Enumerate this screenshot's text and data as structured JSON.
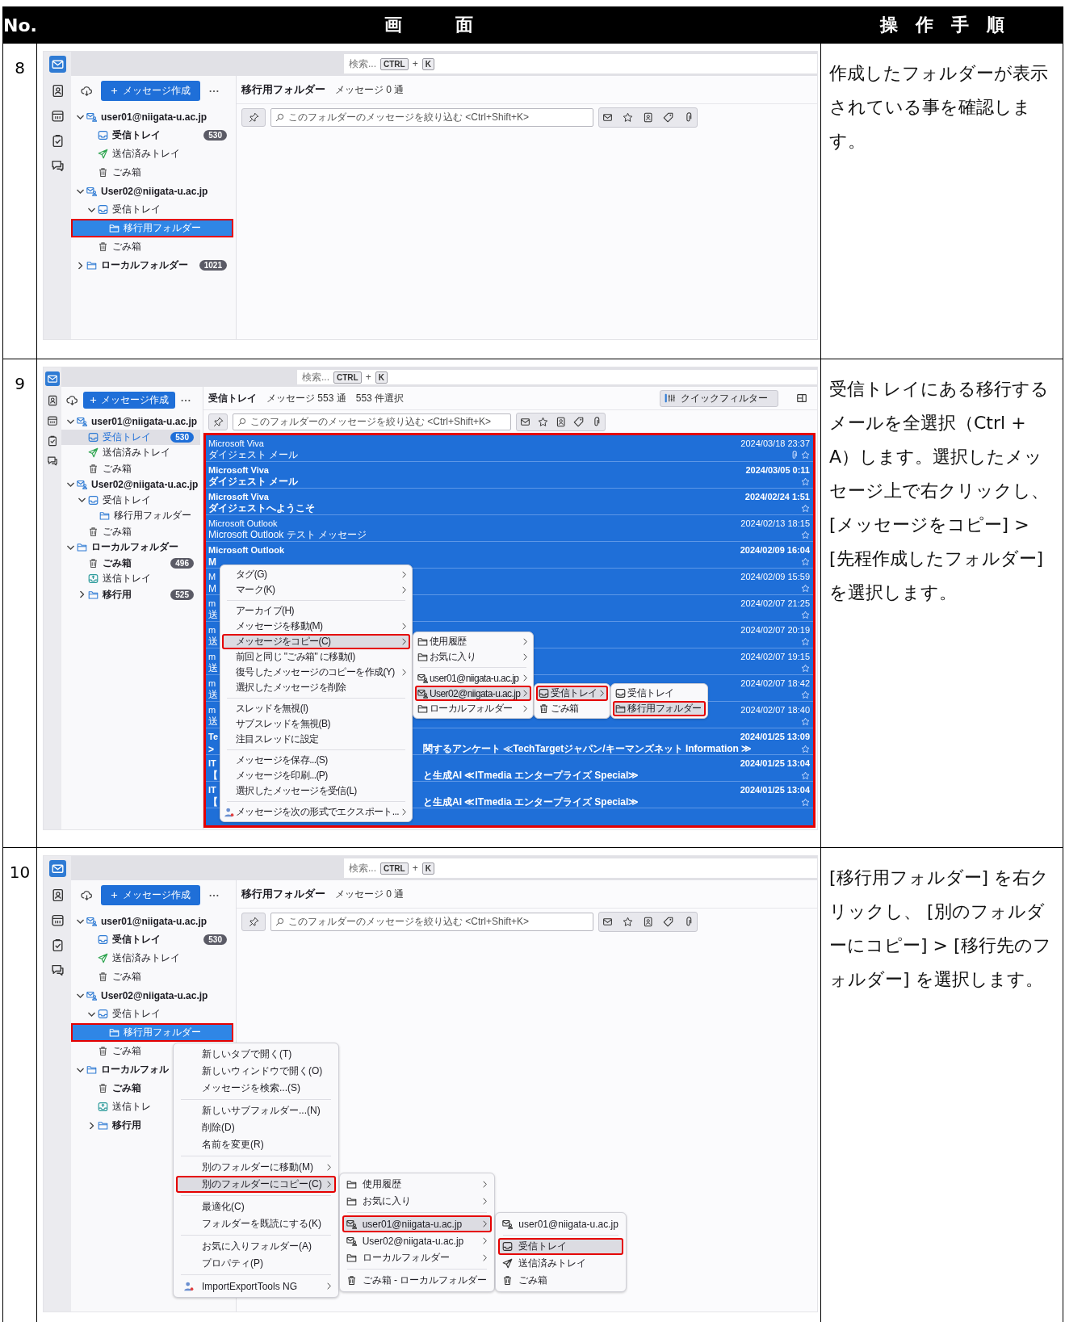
{
  "table": {
    "columns": [
      "No.",
      "画　　　面",
      "操　作　手　順"
    ]
  },
  "rows": [
    {
      "number": "8",
      "instructions": "作成したフォルダーが表示されている事を確認します。",
      "screen": {
        "search": {
          "placeholder": "検索...",
          "joiner": "+",
          "keys": [
            "CTRL",
            "K"
          ]
        },
        "compose_button": "メッセージ作成",
        "folder_pane_focused": true,
        "folders": [
          {
            "label": "user01@niigata-u.ac.jp",
            "kind": "account",
            "bold": true,
            "expanded": true,
            "selected": false,
            "outlined": false,
            "children": [
              {
                "label": "受信トレイ",
                "kind": "inbox",
                "bold": true,
                "count": "530",
                "selected": false,
                "outlined": false
              },
              {
                "label": "送信済みトレイ",
                "kind": "sent",
                "bold": false,
                "selected": false,
                "outlined": false
              },
              {
                "label": "ごみ箱",
                "kind": "trash",
                "bold": false,
                "selected": false,
                "outlined": false
              }
            ]
          },
          {
            "label": "User02@niigata-u.ac.jp",
            "kind": "account",
            "bold": true,
            "expanded": true,
            "selected": false,
            "outlined": false,
            "children": [
              {
                "label": "受信トレイ",
                "kind": "inbox",
                "bold": false,
                "expanded": true,
                "selected": false,
                "outlined": false,
                "children": [
                  {
                    "label": "移行用フォルダー",
                    "kind": "folder",
                    "bold": false,
                    "selected": true,
                    "outlined": true
                  }
                ]
              },
              {
                "label": "ごみ箱",
                "kind": "trash",
                "bold": false,
                "selected": false,
                "outlined": false
              }
            ]
          },
          {
            "label": "ローカルフォルダー",
            "kind": "folder",
            "bold": true,
            "expanded": false,
            "count": "1021",
            "selected": false,
            "outlined": false
          }
        ],
        "folder_title": "移行用フォルダー",
        "folder_info": [
          "メッセージ 0 通"
        ],
        "filter": {
          "placeholder": "このフォルダーのメッセージを絞り込む <Ctrl+Shift+K>"
        }
      }
    },
    {
      "number": "9",
      "instructions": "受信トレイにある移行するメールを全選択（Ctrl + A）します。選択したメッセージ上で右クリックし、[メッセージをコピー] > [先程作成したフォルダー] を選択します。",
      "screen": {
        "search": {
          "placeholder": "検索...",
          "joiner": "+",
          "keys": [
            "CTRL",
            "K"
          ]
        },
        "compose_button": "メッセージ作成",
        "folder_pane_focused": false,
        "folders": [
          {
            "label": "user01@niigata-u.ac.jp",
            "kind": "account",
            "bold": true,
            "expanded": true,
            "selected": false,
            "outlined": false,
            "children": [
              {
                "label": "受信トレイ",
                "kind": "inbox",
                "bold": false,
                "count": "530",
                "selected": true,
                "outlined": false
              },
              {
                "label": "送信済みトレイ",
                "kind": "sent",
                "bold": false,
                "selected": false,
                "outlined": false
              },
              {
                "label": "ごみ箱",
                "kind": "trash",
                "bold": false,
                "selected": false,
                "outlined": false
              }
            ]
          },
          {
            "label": "User02@niigata-u.ac.jp",
            "kind": "account",
            "bold": true,
            "expanded": true,
            "selected": false,
            "outlined": false,
            "children": [
              {
                "label": "受信トレイ",
                "kind": "inbox",
                "bold": false,
                "expanded": true,
                "selected": false,
                "outlined": false,
                "children": [
                  {
                    "label": "移行用フォルダー",
                    "kind": "folder",
                    "bold": false,
                    "selected": false,
                    "outlined": false
                  }
                ]
              },
              {
                "label": "ごみ箱",
                "kind": "trash",
                "bold": false,
                "selected": false,
                "outlined": false
              }
            ]
          },
          {
            "label": "ローカルフォルダー",
            "kind": "folder",
            "bold": true,
            "expanded": true,
            "selected": false,
            "outlined": false,
            "children": [
              {
                "label": "ごみ箱",
                "kind": "trash",
                "bold": true,
                "count": "496",
                "selected": false,
                "outlined": false
              },
              {
                "label": "送信トレイ",
                "kind": "outbox",
                "bold": false,
                "selected": false,
                "outlined": false
              },
              {
                "label": "移行用",
                "kind": "folder",
                "bold": true,
                "expanded": false,
                "count": "525",
                "selected": false,
                "outlined": false
              }
            ]
          }
        ],
        "folder_title": "受信トレイ",
        "folder_info": [
          "メッセージ 553 通",
          "553 件選択"
        ],
        "quick_filter": "クイックフィルター",
        "filter": {
          "placeholder": "このフォルダーのメッセージを絞り込む <Ctrl+Shift+K>"
        },
        "messages_outlined": true,
        "messages": [
          {
            "sender": "Microsoft Viva",
            "subject": "ダイジェスト メール",
            "date": "2024/03/18 23:37",
            "unread": false,
            "attachment": true
          },
          {
            "sender": "Microsoft Viva",
            "subject": "ダイジェスト メール",
            "date": "2024/03/05 0:11",
            "unread": true,
            "attachment": false
          },
          {
            "sender": "Microsoft Viva",
            "subject": "ダイジェストへようこそ",
            "date": "2024/02/24 1:51",
            "unread": true,
            "attachment": false
          },
          {
            "sender": "Microsoft Outlook",
            "subject": "Microsoft Outlook テスト メッセージ",
            "date": "2024/02/13 18:15",
            "unread": false,
            "attachment": false
          },
          {
            "sender": "Microsoft Outlook",
            "subject": "M",
            "date": "2024/02/09 16:04",
            "unread": true,
            "attachment": false
          },
          {
            "sender": "M",
            "subject": "M",
            "date": "2024/02/09 15:59",
            "unread": false,
            "attachment": false
          },
          {
            "sender": "m",
            "subject": "送",
            "date": "2024/02/07 21:25",
            "unread": false,
            "attachment": false
          },
          {
            "sender": "m",
            "subject": "送",
            "date": "2024/02/07 20:19",
            "unread": false,
            "attachment": false
          },
          {
            "sender": "m",
            "subject": "送",
            "date": "2024/02/07 19:15",
            "unread": false,
            "attachment": false
          },
          {
            "sender": "m",
            "subject": "送",
            "date": "2024/02/07 18:42",
            "unread": false,
            "attachment": false
          },
          {
            "sender": "m",
            "subject": "送",
            "date": "2024/02/07 18:40",
            "unread": false,
            "attachment": false
          },
          {
            "sender": "Te",
            "subject": ">",
            "subject_tail": "関するアンケート ≪TechTargetジャパン/キーマンズネット Information ≫",
            "date": "2024/01/25 13:09",
            "unread": true,
            "attachment": false
          },
          {
            "sender": "IT",
            "subject": "【",
            "subject_tail": "と生成AI ≪ITmedia エンタープライズ Special≫",
            "date": "2024/01/25 13:04",
            "unread": true,
            "attachment": false
          },
          {
            "sender": "IT",
            "subject": "【",
            "subject_tail": "と生成AI ≪ITmedia エンタープライズ Special≫",
            "date": "2024/01/25 13:04",
            "unread": true,
            "attachment": false
          }
        ],
        "context_menu": {
          "items": [
            {
              "kind": "item",
              "label": "タグ(G)",
              "arrow": true,
              "selected": false,
              "outlined": false
            },
            {
              "kind": "item",
              "label": "マーク(K)",
              "arrow": true,
              "selected": false,
              "outlined": false
            },
            {
              "kind": "separator"
            },
            {
              "kind": "item",
              "label": "アーカイブ(H)",
              "arrow": false,
              "selected": false,
              "outlined": false
            },
            {
              "kind": "item",
              "label": "メッセージを移動(M)",
              "arrow": true,
              "selected": false,
              "outlined": false
            },
            {
              "kind": "item",
              "label": "メッセージをコピー(C)",
              "arrow": true,
              "selected": true,
              "outlined": true,
              "submenu": {
                "items": [
                  {
                    "kind": "folder",
                    "label": "使用履歴",
                    "arrow": true,
                    "selected": false,
                    "outlined": false
                  },
                  {
                    "kind": "folder",
                    "label": "お気に入り",
                    "arrow": true,
                    "selected": false,
                    "outlined": false
                  },
                  {
                    "kind": "separator"
                  },
                  {
                    "kind": "account",
                    "label": "user01@niigata-u.ac.jp",
                    "arrow": true,
                    "selected": false,
                    "outlined": false
                  },
                  {
                    "kind": "account",
                    "label": "User02@niigata-u.ac.jp",
                    "arrow": true,
                    "selected": true,
                    "outlined": true,
                    "submenu": {
                      "items": [
                        {
                          "kind": "inbox",
                          "label": "受信トレイ",
                          "arrow": true,
                          "selected": true,
                          "outlined": true,
                          "submenu": {
                            "items": [
                              {
                                "kind": "inbox",
                                "label": "受信トレイ",
                                "arrow": false,
                                "selected": false,
                                "outlined": false
                              },
                              {
                                "kind": "folder",
                                "label": "移行用フォルダー",
                                "arrow": false,
                                "selected": true,
                                "outlined": true
                              }
                            ]
                          }
                        },
                        {
                          "kind": "trash",
                          "label": "ごみ箱",
                          "arrow": false,
                          "selected": false,
                          "outlined": false
                        }
                      ]
                    }
                  },
                  {
                    "kind": "folder",
                    "label": "ローカルフォルダー",
                    "arrow": true,
                    "selected": false,
                    "outlined": false
                  }
                ]
              }
            },
            {
              "kind": "item",
              "label": "前回と同じ \"ごみ箱\" に移動(I)",
              "arrow": false,
              "selected": false,
              "outlined": false
            },
            {
              "kind": "item",
              "label": "復号したメッセージのコピーを作成(Y)",
              "arrow": true,
              "selected": false,
              "outlined": false
            },
            {
              "kind": "item",
              "label": "選択したメッセージを削除",
              "arrow": false,
              "selected": false,
              "outlined": false
            },
            {
              "kind": "separator"
            },
            {
              "kind": "item",
              "label": "スレッドを無視(I)",
              "arrow": false,
              "selected": false,
              "outlined": false
            },
            {
              "kind": "item",
              "label": "サブスレッドを無視(B)",
              "arrow": false,
              "selected": false,
              "outlined": false
            },
            {
              "kind": "item",
              "label": "注目スレッドに設定",
              "arrow": false,
              "selected": false,
              "outlined": false
            },
            {
              "kind": "separator"
            },
            {
              "kind": "item",
              "label": "メッセージを保存...(S)",
              "arrow": false,
              "selected": false,
              "outlined": false
            },
            {
              "kind": "item",
              "label": "メッセージを印刷...(P)",
              "arrow": false,
              "selected": false,
              "outlined": false
            },
            {
              "kind": "item",
              "label": "選択したメッセージを受信(L)",
              "arrow": false,
              "selected": false,
              "outlined": false
            },
            {
              "kind": "separator"
            },
            {
              "kind": "export",
              "label": "メッセージを次の形式でエクスポート...",
              "arrow": true,
              "selected": false,
              "outlined": false
            }
          ]
        }
      }
    },
    {
      "number": "10",
      "instructions": "[移行用フォルダー] を右クリックし、 [別のフォルダーにコピー] > [移行先のフォルダー] を選択します。",
      "screen": {
        "search": {
          "placeholder": "検索...",
          "joiner": "+",
          "keys": [
            "CTRL",
            "K"
          ]
        },
        "compose_button": "メッセージ作成",
        "folder_pane_focused": true,
        "folders": [
          {
            "label": "user01@niigata-u.ac.jp",
            "kind": "account",
            "bold": true,
            "expanded": true,
            "selected": false,
            "outlined": false,
            "children": [
              {
                "label": "受信トレイ",
                "kind": "inbox",
                "bold": true,
                "count": "530",
                "selected": false,
                "outlined": false
              },
              {
                "label": "送信済みトレイ",
                "kind": "sent",
                "bold": false,
                "selected": false,
                "outlined": false
              },
              {
                "label": "ごみ箱",
                "kind": "trash",
                "bold": false,
                "selected": false,
                "outlined": false
              }
            ]
          },
          {
            "label": "User02@niigata-u.ac.jp",
            "kind": "account",
            "bold": true,
            "expanded": true,
            "selected": false,
            "outlined": false,
            "children": [
              {
                "label": "受信トレイ",
                "kind": "inbox",
                "bold": false,
                "expanded": true,
                "selected": false,
                "outlined": false,
                "children": [
                  {
                    "label": "移行用フォルダー",
                    "kind": "folder",
                    "bold": false,
                    "selected": true,
                    "outlined": true
                  }
                ]
              },
              {
                "label": "ごみ箱",
                "kind": "trash",
                "bold": false,
                "selected": false,
                "outlined": false
              }
            ]
          },
          {
            "label": "ローカルフォル",
            "kind": "folder",
            "bold": true,
            "expanded": true,
            "selected": false,
            "outlined": false,
            "children": [
              {
                "label": "ごみ箱",
                "kind": "trash",
                "bold": true,
                "selected": false,
                "outlined": false
              },
              {
                "label": "送信トレ",
                "kind": "outbox",
                "bold": false,
                "selected": false,
                "outlined": false
              },
              {
                "label": "移行用",
                "kind": "folder",
                "bold": true,
                "expanded": false,
                "selected": false,
                "outlined": false
              }
            ]
          }
        ],
        "folder_title": "移行用フォルダー",
        "folder_info": [
          "メッセージ 0 通"
        ],
        "filter": {
          "placeholder": "このフォルダーのメッセージを絞り込む <Ctrl+Shift+K>"
        },
        "context_menu": {
          "items": [
            {
              "kind": "item",
              "label": "新しいタブで開く(T)",
              "arrow": false,
              "selected": false,
              "outlined": false
            },
            {
              "kind": "item",
              "label": "新しいウィンドウで開く(O)",
              "arrow": false,
              "selected": false,
              "outlined": false
            },
            {
              "kind": "item",
              "label": "メッセージを検索...(S)",
              "arrow": false,
              "selected": false,
              "outlined": false
            },
            {
              "kind": "separator"
            },
            {
              "kind": "item",
              "label": "新しいサブフォルダー...(N)",
              "arrow": false,
              "selected": false,
              "outlined": false
            },
            {
              "kind": "item",
              "label": "削除(D)",
              "arrow": false,
              "selected": false,
              "outlined": false
            },
            {
              "kind": "item",
              "label": "名前を変更(R)",
              "arrow": false,
              "selected": false,
              "outlined": false
            },
            {
              "kind": "separator"
            },
            {
              "kind": "item",
              "label": "別のフォルダーに移動(M)",
              "arrow": true,
              "selected": false,
              "outlined": false
            },
            {
              "kind": "item",
              "label": "別のフォルダーにコピー(C)",
              "arrow": true,
              "selected": true,
              "outlined": true,
              "submenu": {
                "items": [
                  {
                    "kind": "folder",
                    "label": "使用履歴",
                    "arrow": true,
                    "selected": false,
                    "outlined": false
                  },
                  {
                    "kind": "folder",
                    "label": "お気に入り",
                    "arrow": true,
                    "selected": false,
                    "outlined": false
                  },
                  {
                    "kind": "separator"
                  },
                  {
                    "kind": "account",
                    "label": "user01@niigata-u.ac.jp",
                    "arrow": true,
                    "selected": true,
                    "outlined": true,
                    "submenu": {
                      "items": [
                        {
                          "kind": "account",
                          "label": "user01@niigata-u.ac.jp",
                          "arrow": false,
                          "selected": false,
                          "outlined": false
                        },
                        {
                          "kind": "separator"
                        },
                        {
                          "kind": "inbox",
                          "label": "受信トレイ",
                          "arrow": false,
                          "selected": true,
                          "outlined": true
                        },
                        {
                          "kind": "sent",
                          "label": "送信済みトレイ",
                          "arrow": false,
                          "selected": false,
                          "outlined": false
                        },
                        {
                          "kind": "trash",
                          "label": "ごみ箱",
                          "arrow": false,
                          "selected": false,
                          "outlined": false
                        }
                      ]
                    }
                  },
                  {
                    "kind": "account",
                    "label": "User02@niigata-u.ac.jp",
                    "arrow": true,
                    "selected": false,
                    "outlined": false
                  },
                  {
                    "kind": "folder",
                    "label": "ローカルフォルダー",
                    "arrow": true,
                    "selected": false,
                    "outlined": false
                  },
                  {
                    "kind": "separator"
                  },
                  {
                    "kind": "trash",
                    "label": "ごみ箱 - ローカルフォルダー",
                    "arrow": false,
                    "selected": false,
                    "outlined": false
                  }
                ]
              }
            },
            {
              "kind": "separator"
            },
            {
              "kind": "item",
              "label": "最適化(C)",
              "arrow": false,
              "selected": false,
              "outlined": false
            },
            {
              "kind": "item",
              "label": "フォルダーを既読にする(K)",
              "arrow": false,
              "selected": false,
              "outlined": false
            },
            {
              "kind": "separator"
            },
            {
              "kind": "item",
              "label": "お気に入りフォルダー(A)",
              "arrow": false,
              "selected": false,
              "outlined": false
            },
            {
              "kind": "item",
              "label": "プロパティ(P)",
              "arrow": false,
              "selected": false,
              "outlined": false
            },
            {
              "kind": "separator"
            },
            {
              "kind": "export",
              "label": "ImportExportTools NG",
              "arrow": true,
              "selected": false,
              "outlined": false
            }
          ]
        }
      }
    }
  ]
}
